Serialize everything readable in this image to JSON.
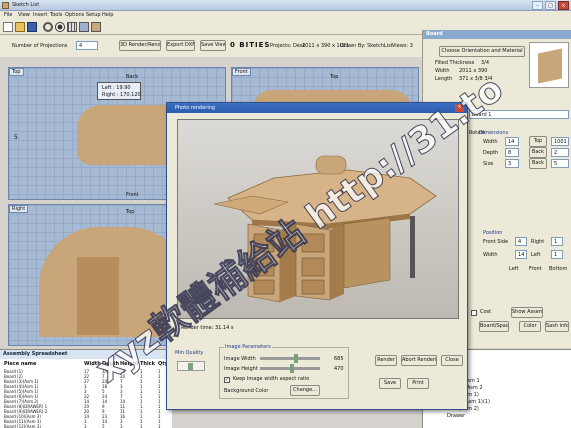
{
  "window": {
    "title": "Sketch List"
  },
  "menu": [
    "File",
    "View",
    "Insert",
    "Tools",
    "Options",
    "Setup",
    "Help"
  ],
  "toolbar": {
    "number_label": "Number of Projections",
    "number_value": "4",
    "btn_a": "3D Render/Render",
    "btn_b": "Export DXF",
    "btn_c": "Save View",
    "status_big": "0 BITIES",
    "status_projects": "Projects: Desk",
    "status_views": "Views: 3",
    "status_extra": "Drawn By: SketchList",
    "status_dims": "2011 x 390 x 1021"
  },
  "views": {
    "top_left_tab": "Top",
    "top_left_back": "Back",
    "top_left_front": "Front",
    "top_right_tab": "Front",
    "top_right_label": "Top",
    "bottom_left_tab": "Right",
    "bottom_left_label": "Top",
    "side_dim": "5",
    "dim_left": "Left : 19.90",
    "dim_right": "Right : 170.120"
  },
  "right_panel": {
    "title": "Board",
    "btn_orient": "Choose Orientation and Material",
    "filled_label": "Filled Thickness",
    "filled_val": "3/4",
    "width_label": "Width",
    "width_val": "2011 x 390",
    "length_label": "Length",
    "length_val": "371 x 3/8 3/4",
    "name_field": "Board 1",
    "rotate_label": "Rotate",
    "dims_label": "Dimensions",
    "dims_rows": [
      {
        "a": "Width",
        "b": "14",
        "c": "Top",
        "d": "1001"
      },
      {
        "a": "Depth",
        "b": "8",
        "c": "Back",
        "d": "2"
      },
      {
        "a": "Size",
        "b": "3",
        "c": "Back",
        "d": "5"
      }
    ],
    "position_label": "Position",
    "pos_rows": [
      {
        "a": "Front Side",
        "b": "4",
        "c": "Right",
        "d": "1"
      },
      {
        "a": "Width",
        "b": "14",
        "c": "Left",
        "d": "1"
      }
    ],
    "pos_foot": [
      "Left",
      "Front",
      "Bottom"
    ],
    "show_label": "Cost",
    "show_val": "Show Assemblies",
    "btn_bottom": [
      "Board/Space",
      "Color",
      "Sash info"
    ]
  },
  "dialog": {
    "title": "Photo rendering",
    "preview_label": "Render time: 31.14 s",
    "quality_label": "Min Quality",
    "params_title": "Image Parameters",
    "image_width_label": "Image Width",
    "image_width_val": "685",
    "image_height_label": "Image Height",
    "image_height_val": "470",
    "keep_ratio": "Keep Image width aspect ratio",
    "bg_label": "Background Color",
    "change_btn": "Change...",
    "render_btn": "Render",
    "abort_btn": "Abort Rendering",
    "close_btn": "Close",
    "save_btn": "Save",
    "print_btn": "Print"
  },
  "assembly": {
    "title": "Assembly Spreadsheet",
    "headers": [
      "Piece name",
      "Width",
      "Depth",
      "Height",
      "Thick",
      "Qty"
    ],
    "rows": [
      [
        "Board (1)",
        "17",
        "3/4",
        "16",
        "1",
        "1"
      ],
      [
        "Board (2)",
        "22",
        "7",
        "20",
        "1",
        "1"
      ],
      [
        "Board (3)(Asm 1)",
        "27",
        "24",
        "7",
        "1",
        "1"
      ],
      [
        "Board (4)(Asm 1)",
        "3",
        "18",
        "3",
        "1",
        "1"
      ],
      [
        "Board (5)(Asm 1)",
        "3",
        "5",
        "3",
        "1",
        "1"
      ],
      [
        "Board (6)(Asm 1)",
        "22",
        "24",
        "7",
        "1",
        "1"
      ],
      [
        "Board (7)(Asm 2)",
        "14",
        "14",
        "14",
        "1",
        "1"
      ],
      [
        "Board (8)(DRAWER) 1",
        "20",
        "9",
        "11",
        "1",
        "1"
      ],
      [
        "Board (9)(DRAWER) 2",
        "20",
        "9",
        "11",
        "1",
        "1"
      ],
      [
        "Board (10)(Asm 3)",
        "14",
        "23",
        "16",
        "1",
        "1"
      ],
      [
        "Board (11)(Asm 3)",
        "3",
        "14",
        "3",
        "1",
        "1"
      ],
      [
        "Board (12)(Asm 3)",
        "3",
        "5",
        "3",
        "1",
        "1"
      ],
      [
        "Board (13)(Asm 3)",
        "14",
        "14",
        "18",
        "1",
        "1"
      ]
    ]
  },
  "tree": {
    "items": [
      "Cabinet/Asm 1",
      "Drawer/Asm 2",
      "Board (Asm 1)",
      "Board (Asm 1)(1)",
      "Board (Asm 2)",
      "Drawer"
    ]
  },
  "watermark": "xyz軟體補給站 http://31.to",
  "colors": {
    "accent": "#8aa9cf",
    "grid": "#a7bad3",
    "wood": "#c9a679",
    "dialog_title": "#2a5db0"
  }
}
